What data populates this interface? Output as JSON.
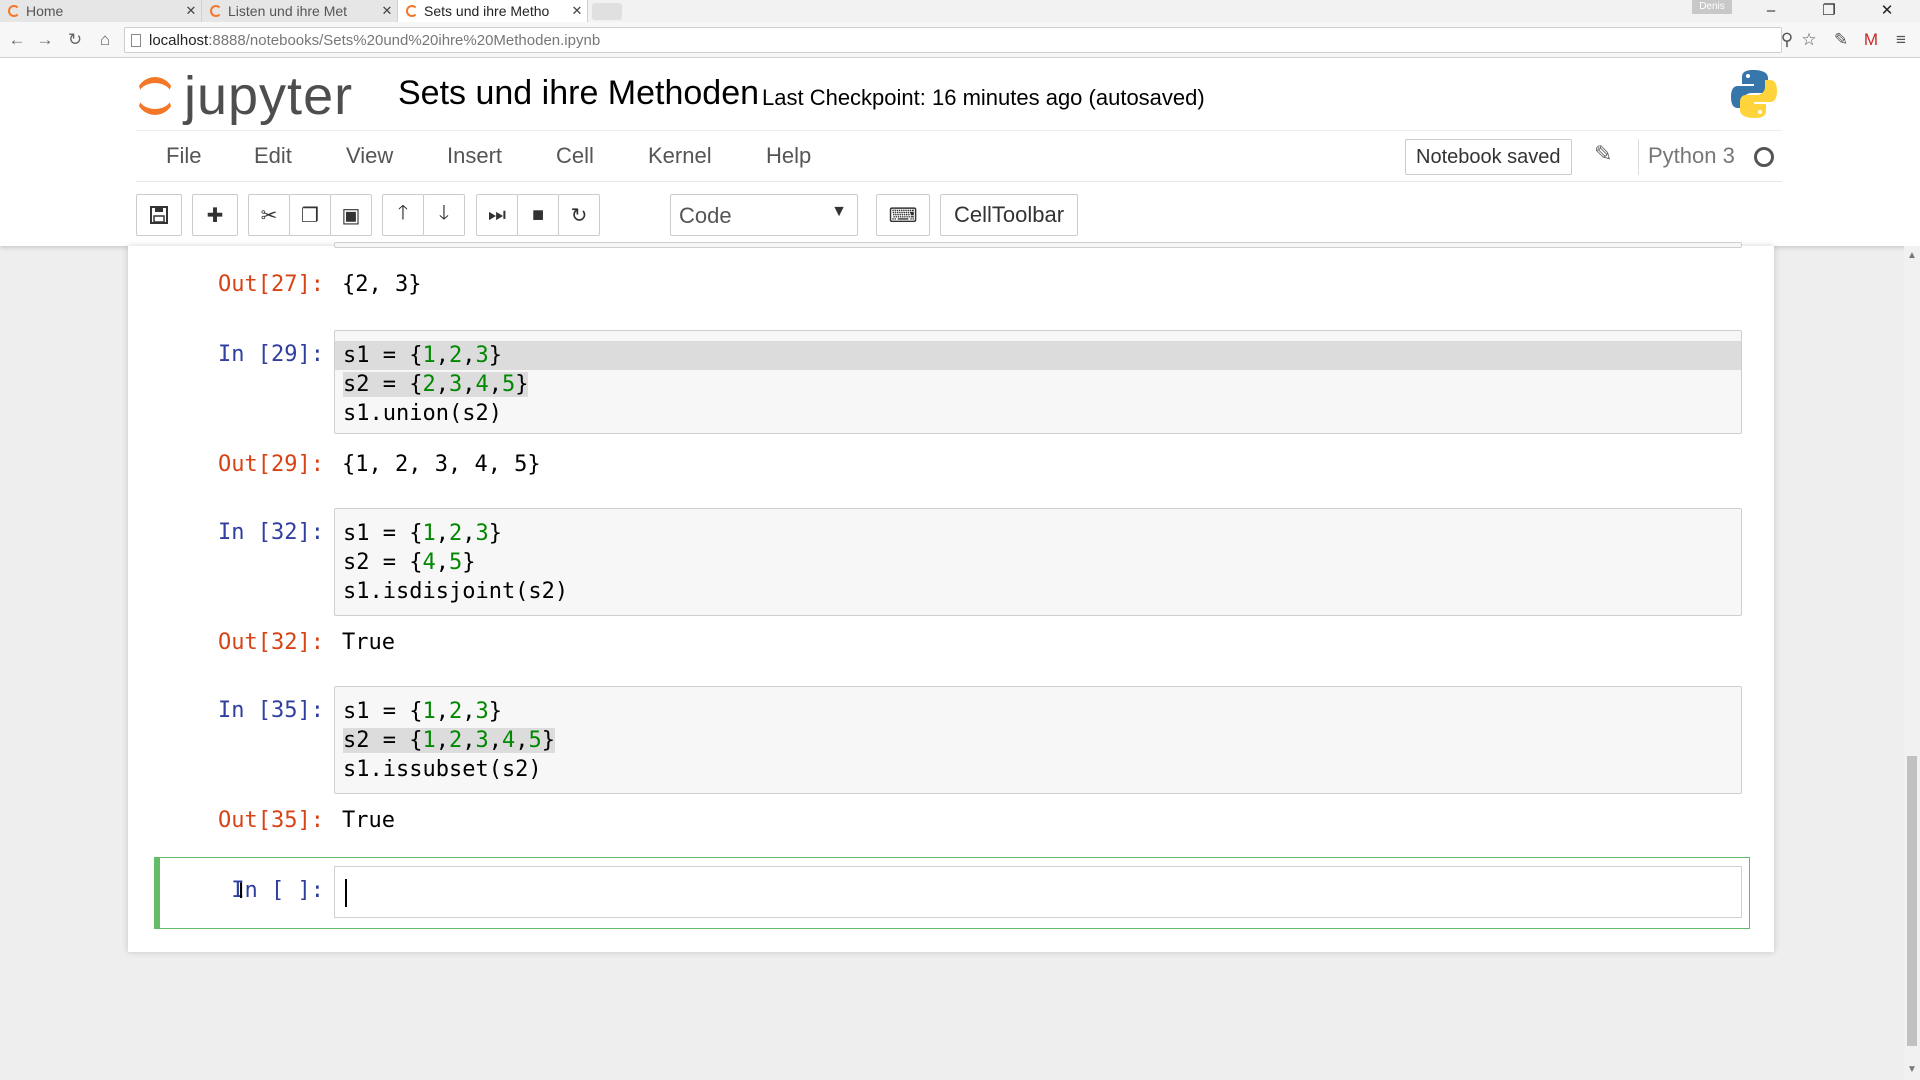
{
  "browser": {
    "tabs": [
      {
        "label": "Home"
      },
      {
        "label": "Listen und ihre Met"
      },
      {
        "label": "Sets und ihre Metho"
      }
    ],
    "user_badge": "Denis",
    "url_host": "localhost",
    "url_rest": ":8888/notebooks/Sets%20und%20ihre%20Methoden.ipynb"
  },
  "header": {
    "logo_text": "jupyter",
    "notebook_title": "Sets und ihre Methoden",
    "checkpoint": "Last Checkpoint: 16 minutes ago (autosaved)"
  },
  "menu": {
    "items": [
      "File",
      "Edit",
      "View",
      "Insert",
      "Cell",
      "Kernel",
      "Help"
    ],
    "notebook_saved": "Notebook saved",
    "kernel_name": "Python 3"
  },
  "toolbar": {
    "cell_type": "Code",
    "celltoolbar_label": "CellToolbar"
  },
  "cells": [
    {
      "out_prompt": "Out[27]:",
      "output": "{2, 3}"
    },
    {
      "in_prompt": "In [29]:",
      "out_prompt": "Out[29]:",
      "output": "{1, 2, 3, 4, 5}"
    },
    {
      "in_prompt": "In [32]:",
      "out_prompt": "Out[32]:",
      "output": "True"
    },
    {
      "in_prompt": "In [35]:",
      "out_prompt": "Out[35]:",
      "output": "True"
    },
    {
      "in_prompt": "In [ ]:"
    }
  ],
  "colors": {
    "jupyter_orange": "#f37726",
    "in_prompt": "#303f9f",
    "out_prompt": "#d84315",
    "number_literal": "#008800",
    "active_cell_border": "#66bb6a"
  }
}
